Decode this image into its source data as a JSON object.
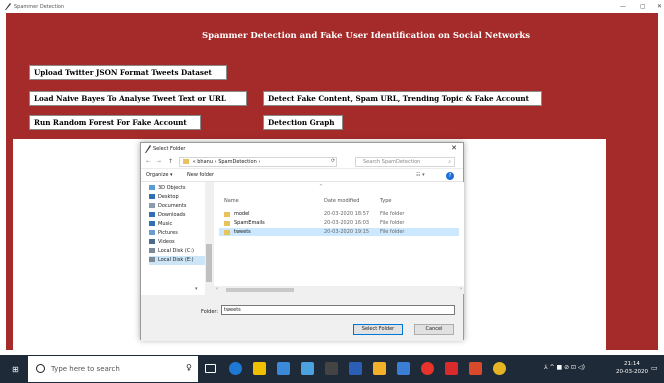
{
  "window": {
    "title": "Spammer Detection",
    "minimize_icon": "—",
    "maximize_icon": "▢",
    "close_icon": "✕"
  },
  "app": {
    "heading": "Spammer Detection and Fake User Identification on Social Networks",
    "buttons": {
      "upload": "Upload Twitter JSON Format Tweets Dataset",
      "naive_bayes": "Load Naive Bayes To Analyse Tweet Text or URL",
      "detect": "Detect Fake Content, Spam URL, Trending Topic & Fake Account",
      "random_forest": "Run Random Forest For Fake Account",
      "graph": "Detection Graph"
    }
  },
  "dialog": {
    "title": "Select Folder",
    "close_icon": "✕",
    "nav": {
      "back": "←",
      "forward": "→",
      "up": "↑"
    },
    "address": {
      "sep": "«",
      "crumbs": [
        "bhanu",
        "SpamDetection"
      ],
      "arrow": "›"
    },
    "search_placeholder": "Search SpamDetection",
    "toolbar": {
      "organize": "Organize ▾",
      "new_folder": "New folder",
      "view": "☷ ▾",
      "help": "?"
    },
    "sidebar": [
      {
        "label": "3D Objects",
        "color": "#5a9bd5"
      },
      {
        "label": "Desktop",
        "color": "#2f6fb5"
      },
      {
        "label": "Documents",
        "color": "#8a9bb0"
      },
      {
        "label": "Downloads",
        "color": "#2f6fb5"
      },
      {
        "label": "Music",
        "color": "#2f6fb5"
      },
      {
        "label": "Pictures",
        "color": "#6a9ccf"
      },
      {
        "label": "Videos",
        "color": "#4a6b8a"
      },
      {
        "label": "Local Disk (C:)",
        "color": "#7a8a99"
      },
      {
        "label": "Local Disk (E:)",
        "color": "#7a8a99"
      }
    ],
    "columns": {
      "name": "Name",
      "date": "Date modified",
      "type": "Type"
    },
    "files": [
      {
        "name": "model",
        "date": "20-03-2020 18:57",
        "type": "File folder"
      },
      {
        "name": "SpamEmails",
        "date": "20-03-2020 16:03",
        "type": "File folder"
      },
      {
        "name": "tweets",
        "date": "20-03-2020 19:15",
        "type": "File folder"
      }
    ],
    "folder_label": "Folder:",
    "folder_value": "tweets",
    "select_button": "Select Folder",
    "cancel_button": "Cancel"
  },
  "taskbar": {
    "search_placeholder": "Type here to search",
    "clock_time": "21:14",
    "clock_date": "20-03-2020",
    "tray": "⅄ ^ ■ ⊘ ⊡ ◁)",
    "lang_icon": "▭"
  }
}
